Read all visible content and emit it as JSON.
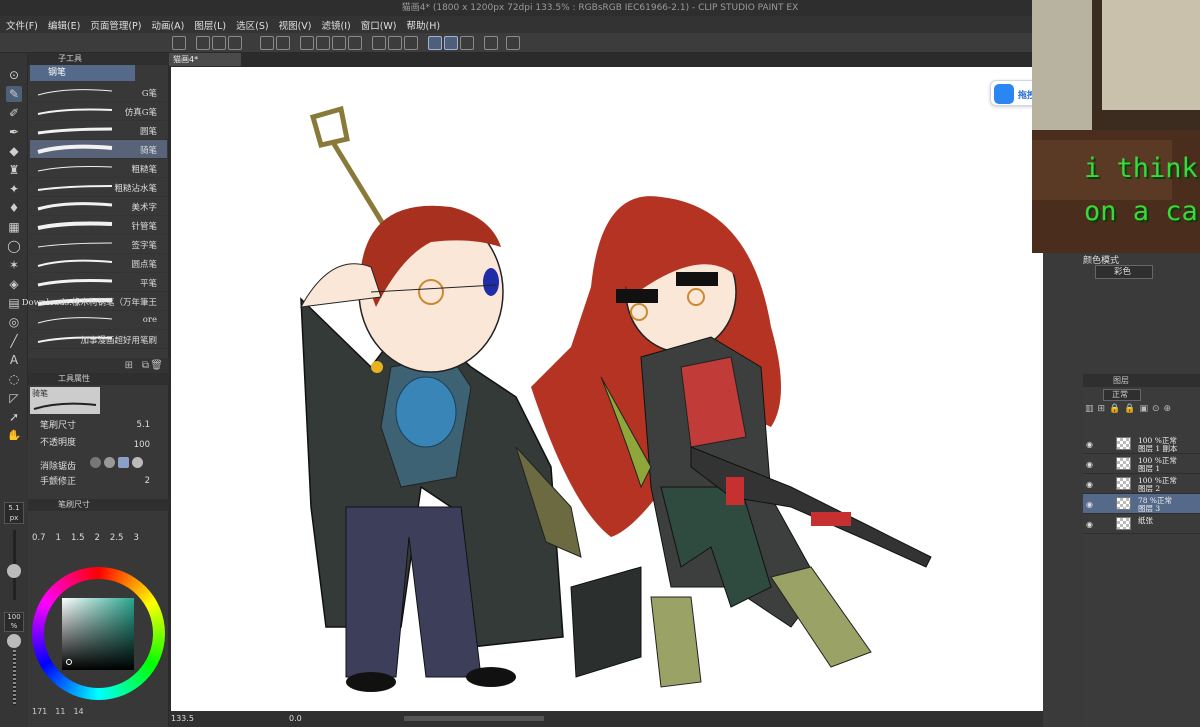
{
  "window": {
    "title": "猫画4* (1800 x 1200px 72dpi 133.5% : RGBsRGB IEC61966-2.1) - CLIP STUDIO PAINT EX"
  },
  "menu": [
    "文件(F)",
    "编辑(E)",
    "页面管理(P)",
    "动画(A)",
    "图层(L)",
    "选区(S)",
    "视图(V)",
    "滤镜(I)",
    "窗口(W)",
    "帮助(H)"
  ],
  "subtool_panel": {
    "tab": "子工具",
    "group": "钢笔",
    "brushes": [
      {
        "label": "G笔",
        "selected": false
      },
      {
        "label": "仿真G笔",
        "selected": false
      },
      {
        "label": "圆笔",
        "selected": false
      },
      {
        "label": "骑笔",
        "selected": true
      },
      {
        "label": "粗糙笔",
        "selected": false
      },
      {
        "label": "粗糙沾水笔",
        "selected": false
      },
      {
        "label": "美术字",
        "selected": false
      },
      {
        "label": "针管笔",
        "selected": false
      },
      {
        "label": "签字笔",
        "selected": false
      },
      {
        "label": "圆点笔",
        "selected": false
      },
      {
        "label": "平笔",
        "selected": false
      },
      {
        "label": "Downloads:橡木柯钢笔（万年筆王",
        "selected": false
      },
      {
        "label": "ore",
        "selected": false
      },
      {
        "label": "加事漫画超好用笔刷",
        "selected": false
      }
    ]
  },
  "tool_property": {
    "tab": "工具属性",
    "preset": "骑笔",
    "rows": [
      {
        "label": "笔刷尺寸",
        "value": "5.1",
        "fill": 0.35
      },
      {
        "label": "不透明度",
        "value": "100",
        "fill": 1.0
      },
      {
        "label": "消除锯齿",
        "value": ""
      },
      {
        "label": "手颤修正",
        "value": "2"
      }
    ]
  },
  "brush_size_panel": {
    "tab": "笔刷尺寸",
    "sizes": [
      "0.7",
      "1",
      "1.5",
      "2",
      "2.5",
      "3"
    ]
  },
  "left_sliders": {
    "size_value": "5.1",
    "size_unit": "px",
    "opacity_value": "100",
    "opacity_unit": "%"
  },
  "canvas": {
    "doc_tab": "猫画4*",
    "status": {
      "zoom": "133.5",
      "angle": "0.0",
      "bottom_left_counts": [
        "171",
        "11",
        "14"
      ]
    }
  },
  "upload_badge": {
    "text": "拖拽至此上传"
  },
  "right": {
    "color_mode_title": "颜色模式",
    "color_mode_value": "彩色",
    "layers_tab": "图层",
    "blend_mode": "正常",
    "layers": [
      {
        "line1": "100 %正常",
        "line2": "图层 1 副本",
        "selected": false
      },
      {
        "line1": "100 %正常",
        "line2": "图层 1",
        "selected": false
      },
      {
        "line1": "100 %正常",
        "line2": "图层 2",
        "selected": false
      },
      {
        "line1": "78 %正常",
        "line2": "图层 3",
        "selected": true
      },
      {
        "line1": "纸张",
        "line2": "",
        "selected": false
      }
    ]
  },
  "webcam": {
    "caption_line1": "i think i",
    "caption_line2": "on a cab"
  },
  "colors": {
    "selected_tool": "#4e5f7a",
    "selected_layer": "#55698a",
    "accent_blue": "#2a86f0",
    "caption_green": "#3ad83a"
  }
}
